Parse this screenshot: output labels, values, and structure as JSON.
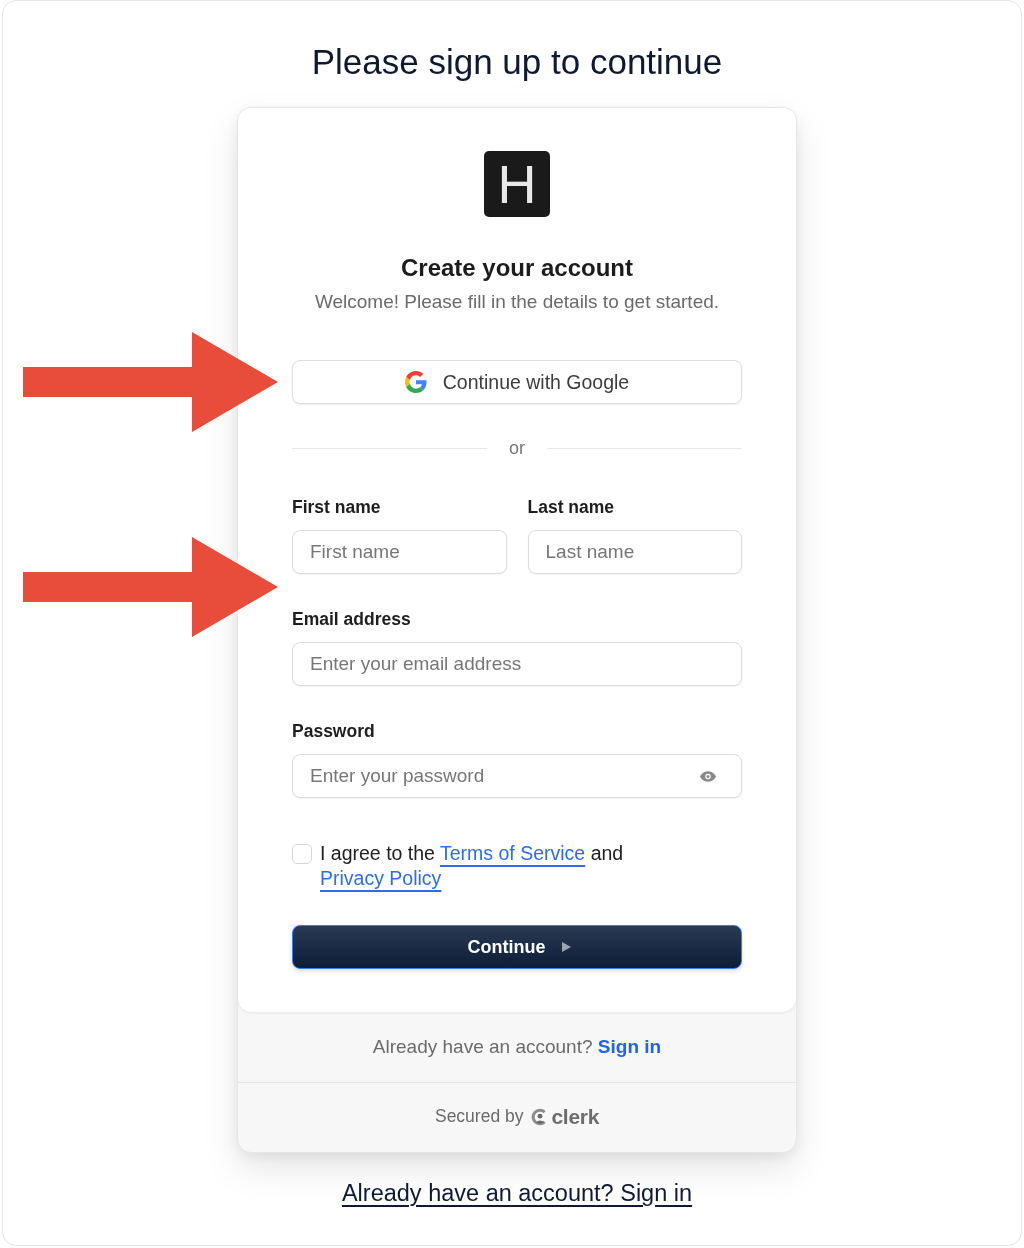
{
  "heading": "Please sign up to continue",
  "annotations": [
    {
      "kind": "arrow"
    },
    {
      "kind": "arrow"
    }
  ],
  "card": {
    "logo": "H",
    "title": "Create your account",
    "subtitle": "Welcome! Please fill in the details to get started.",
    "social_button": {
      "label": "Continue with Google"
    },
    "divider": "or",
    "name_row": [
      {
        "label": "First name",
        "placeholder": "First name"
      },
      {
        "label": "Last name",
        "placeholder": "Last name"
      }
    ],
    "fields": [
      {
        "kind": "email",
        "label": "Email address",
        "placeholder": "Enter your email address"
      },
      {
        "kind": "password",
        "label": "Password",
        "placeholder": "Enter your password"
      }
    ],
    "consent": {
      "checked": false,
      "parts": [
        {
          "kind": "text",
          "text": "I agree to the"
        },
        {
          "kind": "link",
          "text": "Terms of Service"
        },
        {
          "kind": "text",
          "text": "and"
        },
        {
          "kind": "link",
          "text": "Privacy Policy"
        }
      ]
    },
    "submit_button": {
      "label": "Continue"
    },
    "sign_in_prompt": {
      "text": "Already have an account?",
      "link": "Sign in"
    },
    "secured_by": {
      "text": "Secured by",
      "brand": "clerk"
    }
  },
  "bottom_link": "Already have an account? Sign in"
}
